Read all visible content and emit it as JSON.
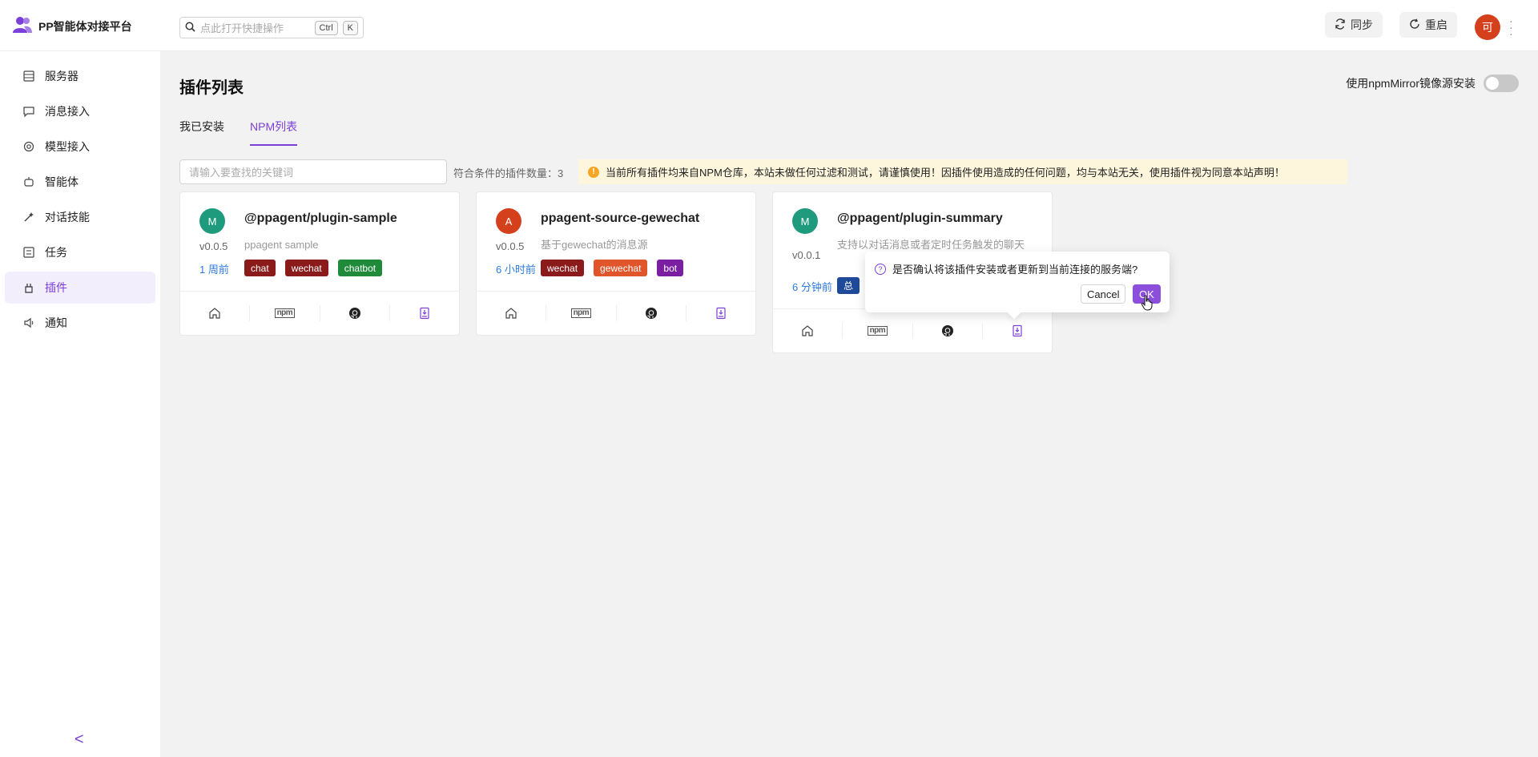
{
  "app": {
    "title": "PP智能体对接平台"
  },
  "search": {
    "placeholder": "点此打开快捷操作",
    "key1": "Ctrl",
    "key2": "K"
  },
  "header": {
    "sync_label": "同步",
    "restart_label": "重启",
    "avatar_text": "可"
  },
  "sidebar": {
    "items": [
      {
        "label": "服务器",
        "icon": "server-icon"
      },
      {
        "label": "消息接入",
        "icon": "message-icon"
      },
      {
        "label": "模型接入",
        "icon": "model-icon"
      },
      {
        "label": "智能体",
        "icon": "agent-icon"
      },
      {
        "label": "对话技能",
        "icon": "skill-icon"
      },
      {
        "label": "任务",
        "icon": "task-icon"
      },
      {
        "label": "插件",
        "icon": "plugin-icon",
        "active": true
      },
      {
        "label": "通知",
        "icon": "notification-icon"
      }
    ],
    "collapse": "<"
  },
  "main": {
    "title": "插件列表",
    "mirror_label": "使用npmMirror镜像源安装",
    "mirror_enabled": false,
    "tabs": [
      {
        "label": "我已安装"
      },
      {
        "label": "NPM列表",
        "active": true
      }
    ],
    "filter_placeholder": "请输入要查找的关键词",
    "count_label": "符合条件的插件数量：3",
    "warning": "当前所有插件均来自NPM仓库，本站未做任何过滤和测试，请谨慎使用！因插件使用造成的任何问题，均与本站无关，使用插件视为同意本站声明！"
  },
  "plugins": [
    {
      "avatar": "M",
      "avatar_color": "#1e9a7c",
      "name": "@ppagent/plugin-sample",
      "version": "v0.0.5",
      "desc": "ppagent sample",
      "time": "1 周前",
      "tags": [
        {
          "label": "chat",
          "color": "#8b1a1a"
        },
        {
          "label": "wechat",
          "color": "#8b1a1a"
        },
        {
          "label": "chatbot",
          "color": "#1e8a3a"
        }
      ]
    },
    {
      "avatar": "A",
      "avatar_color": "#d4401c",
      "name": "ppagent-source-gewechat",
      "version": "v0.0.5",
      "desc": "基于gewechat的消息源",
      "time": "6 小时前",
      "tags": [
        {
          "label": "wechat",
          "color": "#8b1a1a"
        },
        {
          "label": "gewechat",
          "color": "#e0552a"
        },
        {
          "label": "bot",
          "color": "#7a1fa2"
        }
      ]
    },
    {
      "avatar": "M",
      "avatar_color": "#1e9a7c",
      "name": "@ppagent/plugin-summary",
      "version": "v0.0.1",
      "desc": "支持以对话消息或者定时任务触发的聊天",
      "time": "6 分钟前",
      "tags": [
        {
          "label": "总",
          "color": "#1f4a9a"
        }
      ]
    }
  ],
  "popconfirm": {
    "question": "是否确认将该插件安装或者更新到当前连接的服务端?",
    "cancel": "Cancel",
    "ok": "OK"
  }
}
